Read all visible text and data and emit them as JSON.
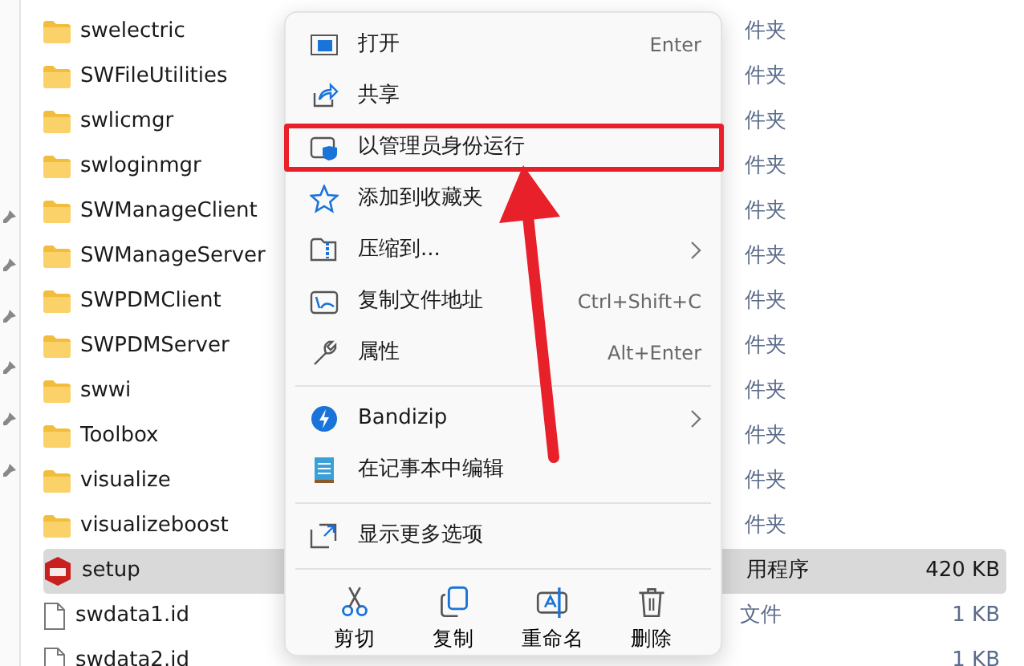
{
  "files": [
    {
      "name": "swelectric",
      "type": "件夹",
      "kind": "folder",
      "selected": false
    },
    {
      "name": "SWFileUtilities",
      "type": "件夹",
      "kind": "folder",
      "selected": false
    },
    {
      "name": "swlicmgr",
      "type": "件夹",
      "kind": "folder",
      "selected": false
    },
    {
      "name": "swloginmgr",
      "type": "件夹",
      "kind": "folder",
      "selected": false
    },
    {
      "name": "SWManageClient",
      "type": "件夹",
      "kind": "folder",
      "selected": false
    },
    {
      "name": "SWManageServer",
      "type": "件夹",
      "kind": "folder",
      "selected": false
    },
    {
      "name": "SWPDMClient",
      "type": "件夹",
      "kind": "folder",
      "selected": false
    },
    {
      "name": "SWPDMServer",
      "type": "件夹",
      "kind": "folder",
      "selected": false
    },
    {
      "name": "swwi",
      "type": "件夹",
      "kind": "folder",
      "selected": false
    },
    {
      "name": "Toolbox",
      "type": "件夹",
      "kind": "folder",
      "selected": false
    },
    {
      "name": "visualize",
      "type": "件夹",
      "kind": "folder",
      "selected": false
    },
    {
      "name": "visualizeboost",
      "type": "件夹",
      "kind": "folder",
      "selected": false
    },
    {
      "name": "setup",
      "type": "用程序",
      "size": "420 KB",
      "kind": "app",
      "selected": true
    },
    {
      "name": "swdata1.id",
      "type": "文件",
      "size": "1 KB",
      "kind": "file",
      "selected": false
    },
    {
      "name": "swdata2.id",
      "size": "1 KB",
      "kind": "file",
      "selected": false
    }
  ],
  "context_menu": {
    "groups": [
      [
        {
          "label": "打开",
          "shortcut": "Enter",
          "annotated": false
        },
        {
          "label": "共享",
          "annotated": false
        },
        {
          "label": "以管理员身份运行",
          "annotated": true
        },
        {
          "label": "添加到收藏夹",
          "annotated": false
        },
        {
          "label": "压缩到...",
          "submenu": true,
          "annotated": false
        },
        {
          "label": "复制文件地址",
          "shortcut": "Ctrl+Shift+C",
          "annotated": false
        },
        {
          "label": "属性",
          "shortcut": "Alt+Enter",
          "annotated": false
        }
      ],
      [
        {
          "label": "Bandizip",
          "submenu": true,
          "annotated": false
        },
        {
          "label": "在记事本中编辑",
          "annotated": false
        }
      ],
      [
        {
          "label": "显示更多选项",
          "annotated": false
        }
      ]
    ],
    "actions": [
      {
        "label": "剪切"
      },
      {
        "label": "复制"
      },
      {
        "label": "重命名"
      },
      {
        "label": "删除"
      }
    ]
  }
}
